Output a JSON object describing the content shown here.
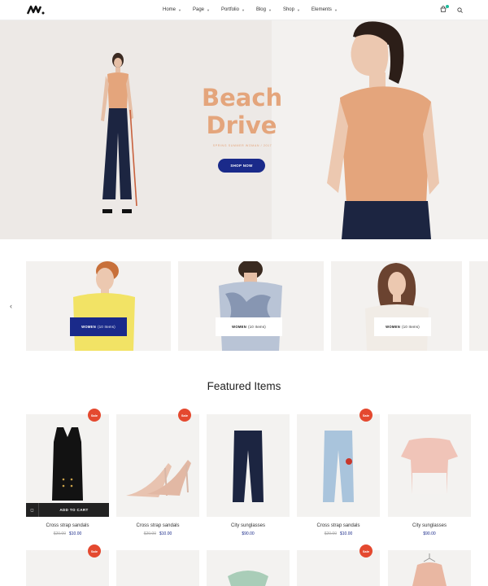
{
  "nav": {
    "items": [
      {
        "label": "Home"
      },
      {
        "label": "Page"
      },
      {
        "label": "Portfolio"
      },
      {
        "label": "Blog"
      },
      {
        "label": "Shop"
      },
      {
        "label": "Elements"
      }
    ]
  },
  "hero": {
    "title_line1": "Beach",
    "title_line2": "Drive",
    "subtitle": "SPRING SUMMER WOMAN / 2017",
    "button": "SHOP NOW"
  },
  "categories": [
    {
      "label": "WOMEN",
      "count": "(10 Items)"
    },
    {
      "label": "WOMEN",
      "count": "(10 Items)"
    },
    {
      "label": "WOMEN",
      "count": "(10 Items)"
    }
  ],
  "featured": {
    "title": "Featured Items",
    "add_to_cart": "ADD TO CART",
    "sale_label": "Sale",
    "products": [
      {
        "name": "Cross strap sandals",
        "old_price": "$20.00",
        "price": "$10.00"
      },
      {
        "name": "Cross strap sandals",
        "old_price": "$20.00",
        "price": "$10.00"
      },
      {
        "name": "City sunglasses",
        "old_price": "",
        "price": "$90.00"
      },
      {
        "name": "Cross strap sandals",
        "old_price": "$20.00",
        "price": "$10.00"
      },
      {
        "name": "City sunglasses",
        "old_price": "",
        "price": "$90.00"
      }
    ]
  },
  "colors": {
    "accent": "#e4a57c",
    "button": "#1a2a8a",
    "sale": "#e4492f",
    "cart_badge": "#1abc9c"
  },
  "icons": [
    "logo-icon",
    "cart-icon",
    "search-icon",
    "chevron-left-icon",
    "chevron-right-icon",
    "quick-view-icon"
  ]
}
